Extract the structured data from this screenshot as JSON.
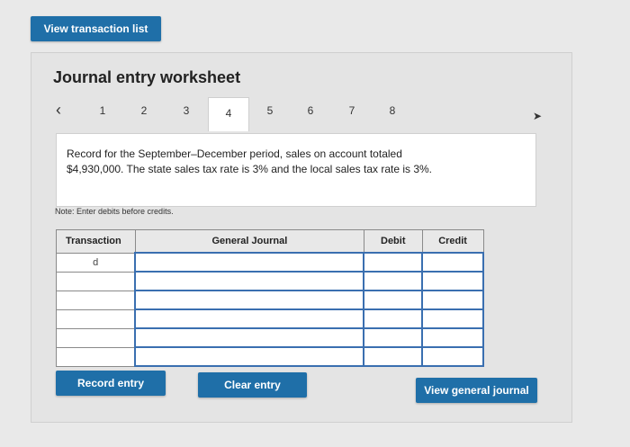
{
  "header": {
    "view_list_label": "View transaction list"
  },
  "worksheet": {
    "title": "Journal entry worksheet",
    "tabs": [
      "1",
      "2",
      "3",
      "4",
      "5",
      "6",
      "7",
      "8"
    ],
    "active_tab": "4",
    "prompt_line1": "Record for the September–December period, sales on account totaled",
    "prompt_line2": "$4,930,000. The state sales tax rate is 3% and the local sales tax rate is 3%.",
    "note": "Note: Enter debits before credits."
  },
  "table": {
    "headers": [
      "Transaction",
      "General Journal",
      "Debit",
      "Credit"
    ],
    "rows": [
      [
        "d",
        "",
        "",
        ""
      ],
      [
        "",
        "",
        "",
        ""
      ],
      [
        "",
        "",
        "",
        ""
      ],
      [
        "",
        "",
        "",
        ""
      ],
      [
        "",
        "",
        "",
        ""
      ],
      [
        "",
        "",
        "",
        ""
      ]
    ]
  },
  "buttons": {
    "record": "Record entry",
    "clear": "Clear entry",
    "view_journal": "View general journal"
  },
  "icons": {
    "prev": "chevron-left-icon",
    "cursor": "cursor-icon"
  }
}
